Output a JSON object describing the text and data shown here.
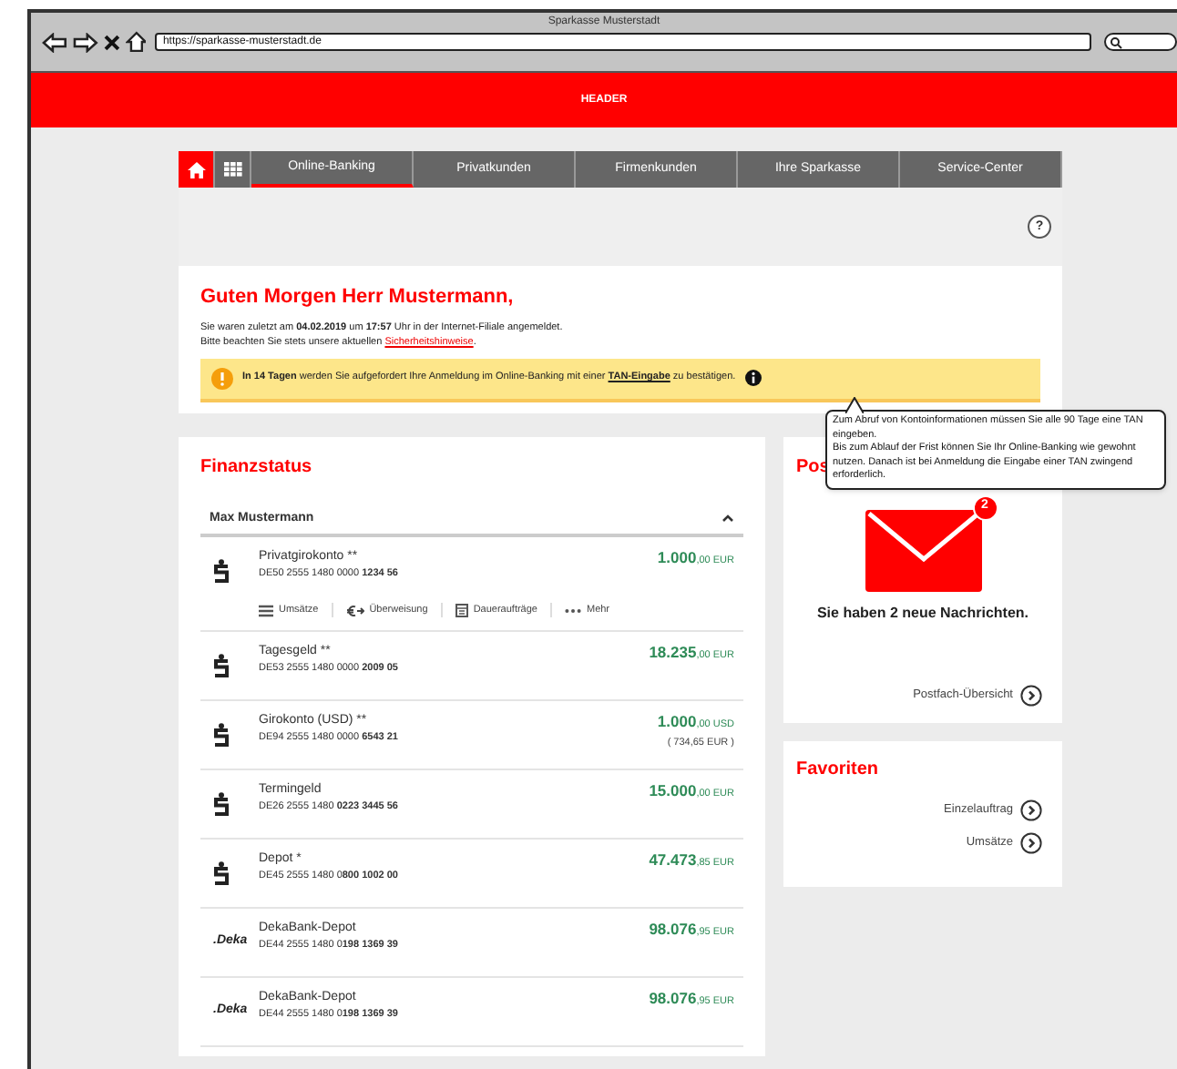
{
  "window": {
    "title": "Sparkasse Musterstadt",
    "url": "https://sparkasse-musterstadt.de"
  },
  "header": {
    "label": "HEADER"
  },
  "nav": {
    "tabs": [
      {
        "label": "Online-Banking",
        "selected": true
      },
      {
        "label": "Privatkunden",
        "selected": false
      },
      {
        "label": "Firmenkunden",
        "selected": false
      },
      {
        "label": "Ihre Sparkasse",
        "selected": false
      },
      {
        "label": "Service-Center",
        "selected": false
      }
    ]
  },
  "help": {
    "label": "?"
  },
  "greeting": {
    "title": "Guten Morgen Herr Mustermann,",
    "last_login": "Sie waren zuletzt am **04.02.2019** um **17:57** Uhr in der Internet-Filiale angemeldet.",
    "security_prefix": "Bitte beachten Sie stets unsere aktuellen",
    "security_link": "Sicherheitshinweise",
    "security_suffix": "."
  },
  "notice": {
    "prefix": "**In 14 Tagen** werden Sie aufgefordert Ihre Anmeldung im Online-Banking mit einer",
    "link": "TAN-Eingabe",
    "suffix": "zu bestätigen."
  },
  "tooltip": {
    "paragraphs": [
      "Zum Abruf von Kontoinformationen müssen Sie alle 90 Tage eine TAN eingeben.",
      "Bis zum Ablauf der Frist können Sie Ihr Online-Banking wie gewohnt nutzen. Danach ist bei Anmeldung die Eingabe einer TAN zwingend erforderlich."
    ]
  },
  "finanzstatus": {
    "title": "Finanzstatus",
    "owner": "Max Mustermann",
    "expanded": true,
    "accounts": [
      {
        "kind": "sparkasse",
        "name": "Privatgirokonto **",
        "iban": "DE50 2555 1480 0000 **1234 56**",
        "amount": "**1.000**,00 EUR",
        "actions": [
          {
            "kind": "list",
            "label": "Umsätze"
          },
          {
            "kind": "transfer",
            "label": "Überweisung"
          },
          {
            "kind": "calendar",
            "label": "Daueraufträge"
          },
          {
            "kind": "more",
            "label": "Mehr"
          }
        ]
      },
      {
        "kind": "sparkasse",
        "name": "Tagesgeld **",
        "iban": "DE53 2555 1480 0000 **2009 05**",
        "amount": "**18.235**,00 EUR"
      },
      {
        "kind": "sparkasse",
        "name": "Girokonto (USD) **",
        "iban": "DE94 2555 1480 0000 **6543 21**",
        "amount": "**1.000**,00 USD",
        "converted": "( 734,65 EUR )"
      },
      {
        "kind": "sparkasse",
        "name": "Termingeld",
        "iban": "DE26 2555 1480 **0223 3445 56**",
        "amount": "**15.000**,00 EUR"
      },
      {
        "kind": "sparkasse",
        "name": "Depot *",
        "iban": "DE45 2555 1480 0**800 1002 00**",
        "amount": "**47.473**,85 EUR"
      },
      {
        "kind": "deka",
        "logo_text": ".Deka",
        "name": "DekaBank-Depot",
        "iban": "DE44 2555 1480 0**198 1369 39**",
        "amount": "**98.076**,95 EUR"
      },
      {
        "kind": "deka",
        "logo_text": ".Deka",
        "name": "DekaBank-Depot",
        "iban": "DE44 2555 1480 0**198 1369 39**",
        "amount": "**98.076**,95 EUR"
      }
    ]
  },
  "postfach": {
    "title": "Pos",
    "badge": "2",
    "message": "Sie haben 2 neue Nachrichten.",
    "link": "Postfach-Übersicht"
  },
  "favoriten": {
    "title": "Favoriten",
    "links": [
      "Einzelauftrag",
      "Umsätze"
    ]
  }
}
